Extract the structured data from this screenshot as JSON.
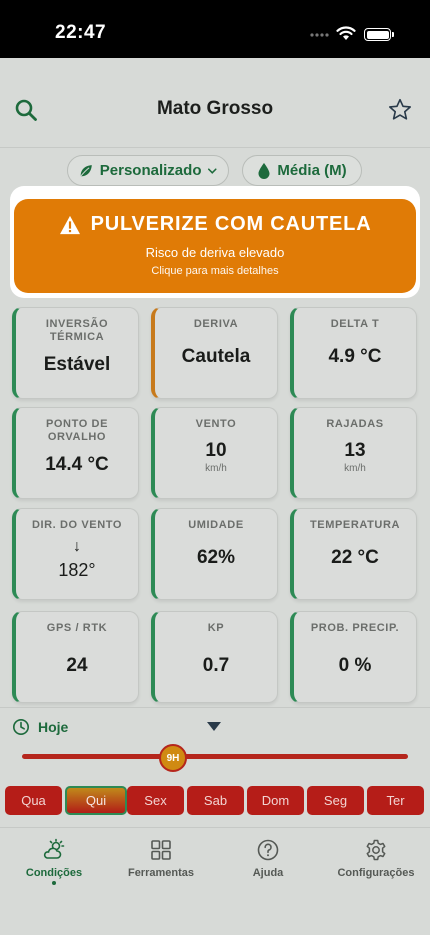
{
  "status_bar": {
    "time": "22:47"
  },
  "header": {
    "title": "Mato Grosso"
  },
  "chips": {
    "profile": "Personalizado",
    "volume": "Média (M)"
  },
  "alert": {
    "title": "PULVERIZE COM CAUTELA",
    "subtitle": "Risco de deriva elevado",
    "hint": "Clique para mais detalhes",
    "color": "#e07b06"
  },
  "cards": {
    "inversao": {
      "label": "INVERSÃO TÉRMICA",
      "value": "Estável"
    },
    "deriva": {
      "label": "DERIVA",
      "value": "Cautela"
    },
    "delta_t": {
      "label": "DELTA T",
      "value": "4.9 °C"
    },
    "orvalho": {
      "label": "PONTO DE ORVALHO",
      "value": "14.4 °C"
    },
    "vento": {
      "label": "VENTO",
      "value": "10",
      "unit": "km/h"
    },
    "rajadas": {
      "label": "RAJADAS",
      "value": "13",
      "unit": "km/h"
    },
    "dir_vento": {
      "label": "DIR. DO VENTO",
      "arrow": "↓",
      "value": "182°"
    },
    "umidade": {
      "label": "UMIDADE",
      "value": "62%"
    },
    "temperatura": {
      "label": "TEMPERATURA",
      "value": "22 °C"
    },
    "gps": {
      "label": "GPS / RTK",
      "value": "24"
    },
    "kp": {
      "label": "KP",
      "value": "0.7"
    },
    "prob": {
      "label": "PROB. PRECIP.",
      "value": "0 %"
    }
  },
  "timeline": {
    "day_label": "Hoje",
    "hour": "9H",
    "days": [
      "Qua",
      "Qui",
      "Sex",
      "Sab",
      "Dom",
      "Seg",
      "Ter"
    ],
    "selected_day": "Qui"
  },
  "tabs": {
    "conditions": "Condições",
    "tools": "Ferramentas",
    "help": "Ajuda",
    "settings": "Configurações"
  },
  "colors": {
    "brand_green": "#1d6a3c",
    "warning_orange": "#e07b06",
    "danger_red": "#b51d18"
  }
}
